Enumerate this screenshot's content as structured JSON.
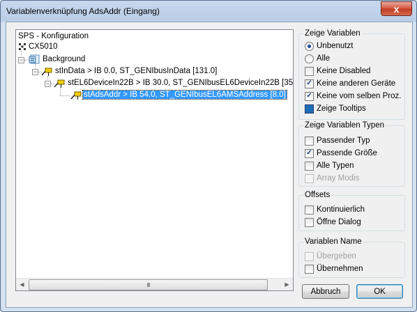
{
  "window": {
    "title": "Variablenverknüpfung AdsAddr (Eingang)",
    "close_glyph": "x"
  },
  "tree": {
    "root_label": "SPS - Konfiguration",
    "device": "CX5010",
    "background": "Background",
    "node1": "stInData   >   IB 0.0, ST_GENIbusInData [131.0]",
    "node2": "stEL6DeviceIn22B   >   IB 30.0, ST_GENIbusEL6DeviceIn22B [35",
    "node3": "stAdsAddr   >   IB 54.0, ST_GENIbusEL6AMSAddress [8.0]",
    "scroll_grip": "III"
  },
  "groups": {
    "zeige_variablen": {
      "label": "Zeige Variablen",
      "unbenutzt": "Unbenutzt",
      "alle": "Alle",
      "keine_disabled": "Keine Disabled",
      "keine_anderen": "Keine anderen Geräte",
      "keine_vom_selben": "Keine vom selben Proz.",
      "zeige_tooltips": "Zeige Tooltips"
    },
    "zeige_typen": {
      "label": "Zeige Variablen Typen",
      "passender_typ": "Passender Typ",
      "passende_groesse": "Passende Größe",
      "alle_typen": "Alle Typen",
      "array_modis": "Array Modis"
    },
    "offsets": {
      "label": "Offsets",
      "kontinuierlich": "Kontinuierlich",
      "oeffne_dialog": "Öffne Dialog"
    },
    "variablen_name": {
      "label": "Variablen Name",
      "uebergeben": "Übergeben",
      "uebernehmen": "Übernehmen"
    }
  },
  "buttons": {
    "abbruch": "Abbruch",
    "ok": "OK"
  },
  "checked_glyph": "✓",
  "colors": {
    "selection": "#3399ff",
    "checkbox_check": "#1a3b7a"
  }
}
